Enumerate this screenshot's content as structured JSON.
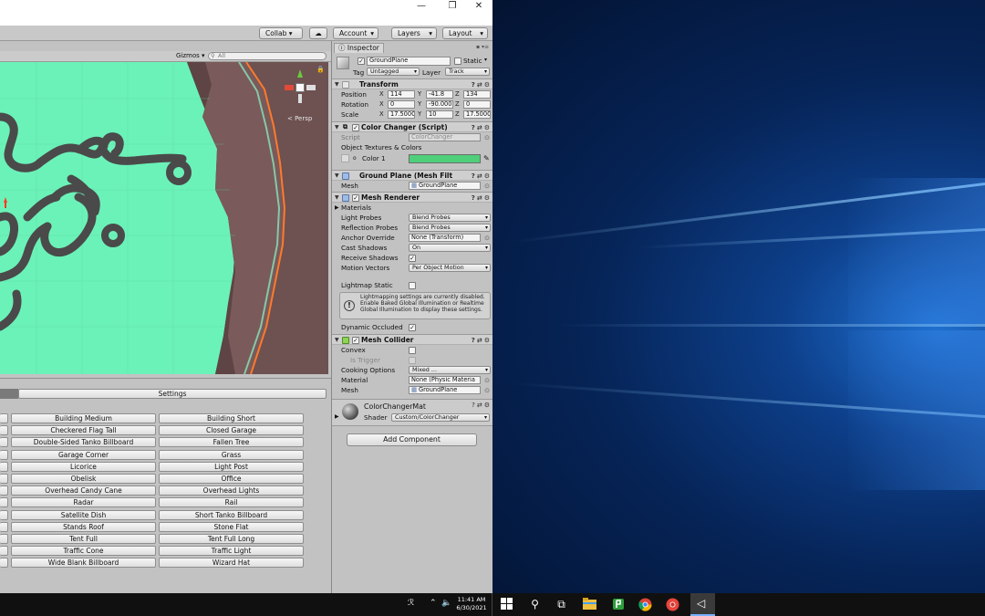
{
  "window": {
    "minimize": "—",
    "maximize": "❐",
    "close": "✕"
  },
  "toolbar": {
    "collab": "Collab ▾",
    "account": "Account",
    "layers": "Layers",
    "layout": "Layout"
  },
  "scene": {
    "gizmos": "Gizmos ▾",
    "search_placeholder": "All",
    "persp": "< Persp",
    "colors": {
      "ground": "#6bf2b8",
      "wall": "#6e5151",
      "track": "#4a4a4a",
      "edge": "#ff7a2a"
    }
  },
  "bottom_panel": {
    "settings": "Settings",
    "col1": [
      "Building Medium",
      "Checkered Flag Tall",
      "Double-Sided Tanko Billboard",
      "Garage Corner",
      "Licorice",
      "Obelisk",
      "Overhead Candy Cane",
      "Radar",
      "Satellite Dish",
      "Stands Roof",
      "Tent Full",
      "Traffic Cone",
      "Wide Blank Billboard"
    ],
    "col2": [
      "Building Short",
      "Closed Garage",
      "Fallen Tree",
      "Grass",
      "Light Post",
      "Office",
      "Overhead Lights",
      "Rail",
      "Short Tanko Billboard",
      "Stone Flat",
      "Tent Full Long",
      "Traffic Light",
      "Wizard Hat"
    ]
  },
  "inspector": {
    "tab": "Inspector",
    "object_name": "GroundPlane",
    "static_label": "Static",
    "tag_label": "Tag",
    "tag_value": "Untagged",
    "layer_label": "Layer",
    "layer_value": "Track",
    "transform": {
      "title": "Transform",
      "position_label": "Position",
      "rotation_label": "Rotation",
      "scale_label": "Scale",
      "position": [
        "114",
        "-41.8",
        "134"
      ],
      "rotation": [
        "0",
        "-90.000",
        "0"
      ],
      "scale": [
        "17.500C",
        "10",
        "17.500C"
      ]
    },
    "color_changer": {
      "title": "Color Changer (Script)",
      "script_label": "Script",
      "script_value": "ColorChanger",
      "textures_label": "Object Textures & Colors",
      "color1_label": "Color 1",
      "color1": "#4fcf7a"
    },
    "mesh_filter": {
      "title": "Ground Plane (Mesh Filt",
      "mesh_label": "Mesh",
      "mesh_value": "GroundPlane"
    },
    "mesh_renderer": {
      "title": "Mesh Renderer",
      "materials_label": "Materials",
      "light_probes_label": "Light Probes",
      "light_probes_value": "Blend Probes",
      "reflection_probes_label": "Reflection Probes",
      "reflection_probes_value": "Blend Probes",
      "anchor_label": "Anchor Override",
      "anchor_value": "None (Transform)",
      "cast_shadows_label": "Cast Shadows",
      "cast_shadows_value": "On",
      "receive_shadows_label": "Receive Shadows",
      "motion_vectors_label": "Motion Vectors",
      "motion_vectors_value": "Per Object Motion",
      "lightmap_static_label": "Lightmap Static",
      "lightmap_info": "Lightmapping settings are currently disabled. Enable Baked Global Illumination or Realtime Global Illumination to display these settings.",
      "dynamic_occluded_label": "Dynamic Occluded"
    },
    "mesh_collider": {
      "title": "Mesh Collider",
      "convex_label": "Convex",
      "is_trigger_label": "Is Trigger",
      "cooking_label": "Cooking Options",
      "cooking_value": "Mixed ...",
      "material_label": "Material",
      "material_value": "None (Physic Materia",
      "mesh_label": "Mesh",
      "mesh_value": "GroundPlane"
    },
    "material": {
      "name": "ColorChangerMat",
      "shader_label": "Shader",
      "shader_value": "Custom/ColorChanger"
    },
    "add_component": "Add Component"
  },
  "taskbar": {
    "time": "11:41 AM",
    "date": "6/30/2021"
  }
}
